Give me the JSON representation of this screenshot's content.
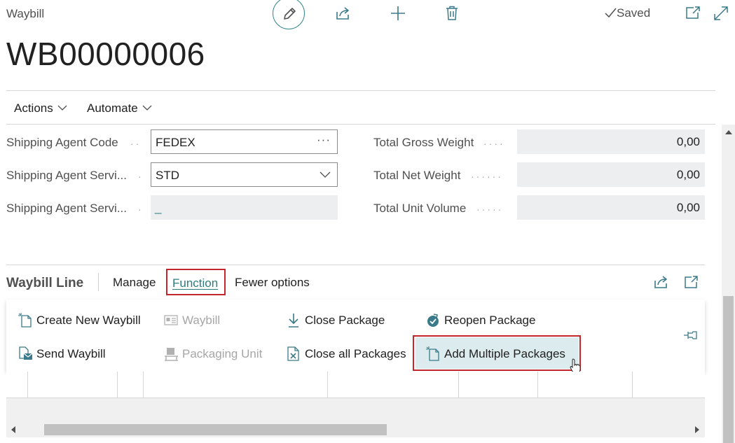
{
  "header": {
    "caption": "Waybill",
    "title": "WB00000006",
    "saved_label": "Saved",
    "icons": [
      "pencil-icon",
      "share-icon",
      "plus-icon",
      "trash-icon",
      "open-new-window-icon",
      "expand-icon"
    ]
  },
  "action_bar": {
    "items": [
      {
        "label": "Actions"
      },
      {
        "label": "Automate"
      }
    ]
  },
  "fields": {
    "shipping_agent_code": {
      "label": "Shipping Agent Code",
      "value": "FEDEX"
    },
    "shipping_agent_service": {
      "label": "Shipping Agent Servi...",
      "value": "STD"
    },
    "shipping_agent_service2": {
      "label": "Shipping Agent Servi...",
      "value": "_"
    },
    "total_gross_weight": {
      "label": "Total Gross Weight",
      "value": "0,00"
    },
    "total_net_weight": {
      "label": "Total Net Weight",
      "value": "0,00"
    },
    "total_unit_volume": {
      "label": "Total Unit Volume",
      "value": "0,00"
    }
  },
  "lines": {
    "title": "Waybill Line",
    "tabs": [
      {
        "label": "Manage"
      },
      {
        "label": "Function",
        "active": true
      },
      {
        "label": "Fewer options"
      }
    ],
    "menu": [
      {
        "label": "Create New Waybill",
        "icon": "new-document-icon",
        "enabled": true
      },
      {
        "label": "Waybill",
        "icon": "card-icon",
        "enabled": false
      },
      {
        "label": "Close Package",
        "icon": "download-arrow-icon",
        "enabled": true
      },
      {
        "label": "Reopen Package",
        "icon": "reopen-check-icon",
        "enabled": true
      },
      {
        "label": "Send Waybill",
        "icon": "send-document-icon",
        "enabled": true
      },
      {
        "label": "Packaging Unit",
        "icon": "packaging-icon",
        "enabled": false
      },
      {
        "label": "Close all Packages",
        "icon": "close-document-icon",
        "enabled": true
      },
      {
        "label": "Add Multiple Packages",
        "icon": "new-document-icon",
        "enabled": true,
        "highlighted": true
      }
    ]
  },
  "colors": {
    "accent": "#2e7d7d",
    "highlight_border": "#c4262e",
    "highlight_fill": "#dcecee",
    "readonly_fill": "#eceeef"
  }
}
